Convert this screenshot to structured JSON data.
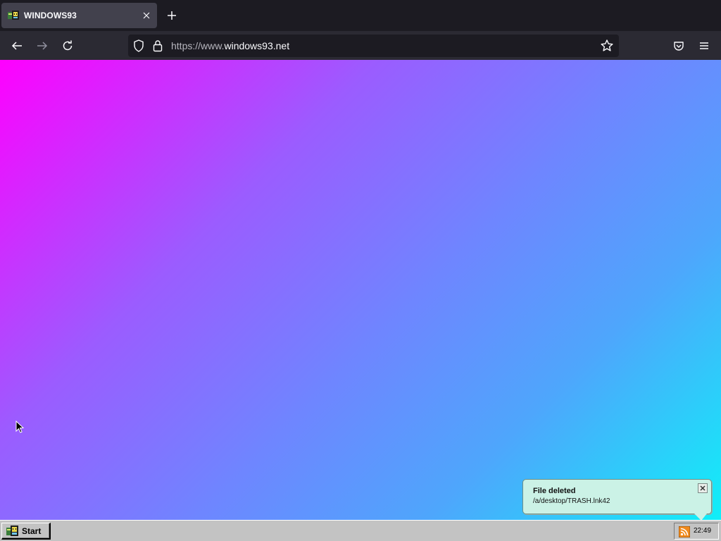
{
  "browser": {
    "tab": {
      "title": "WINDOWS93",
      "favicon": "windows93-favicon"
    },
    "url": {
      "prefix": "https://www.",
      "domain": "windows93.net"
    },
    "icons": [
      "back-icon",
      "forward-icon",
      "reload-icon",
      "shield-icon",
      "lock-icon",
      "star-icon",
      "pocket-icon",
      "menu-icon",
      "new-tab-icon",
      "close-icon"
    ]
  },
  "desktop": {
    "gradient": [
      "#ff00ff",
      "#9b5cff",
      "#6f85ff",
      "#4ea6fc",
      "#10eff8"
    ]
  },
  "notification": {
    "title": "File deleted",
    "message": "/a/desktop/TRASH.lnk42"
  },
  "taskbar": {
    "start_label": "Start",
    "clock": "22:49",
    "tray_icon": "rss-icon"
  },
  "colors": {
    "chrome_dark": "#1c1b22",
    "chrome_nav": "#2b2a33",
    "tab_active": "#42414d",
    "taskbar": "#c3c3c3",
    "notify_bg": "#cbf2e6"
  }
}
